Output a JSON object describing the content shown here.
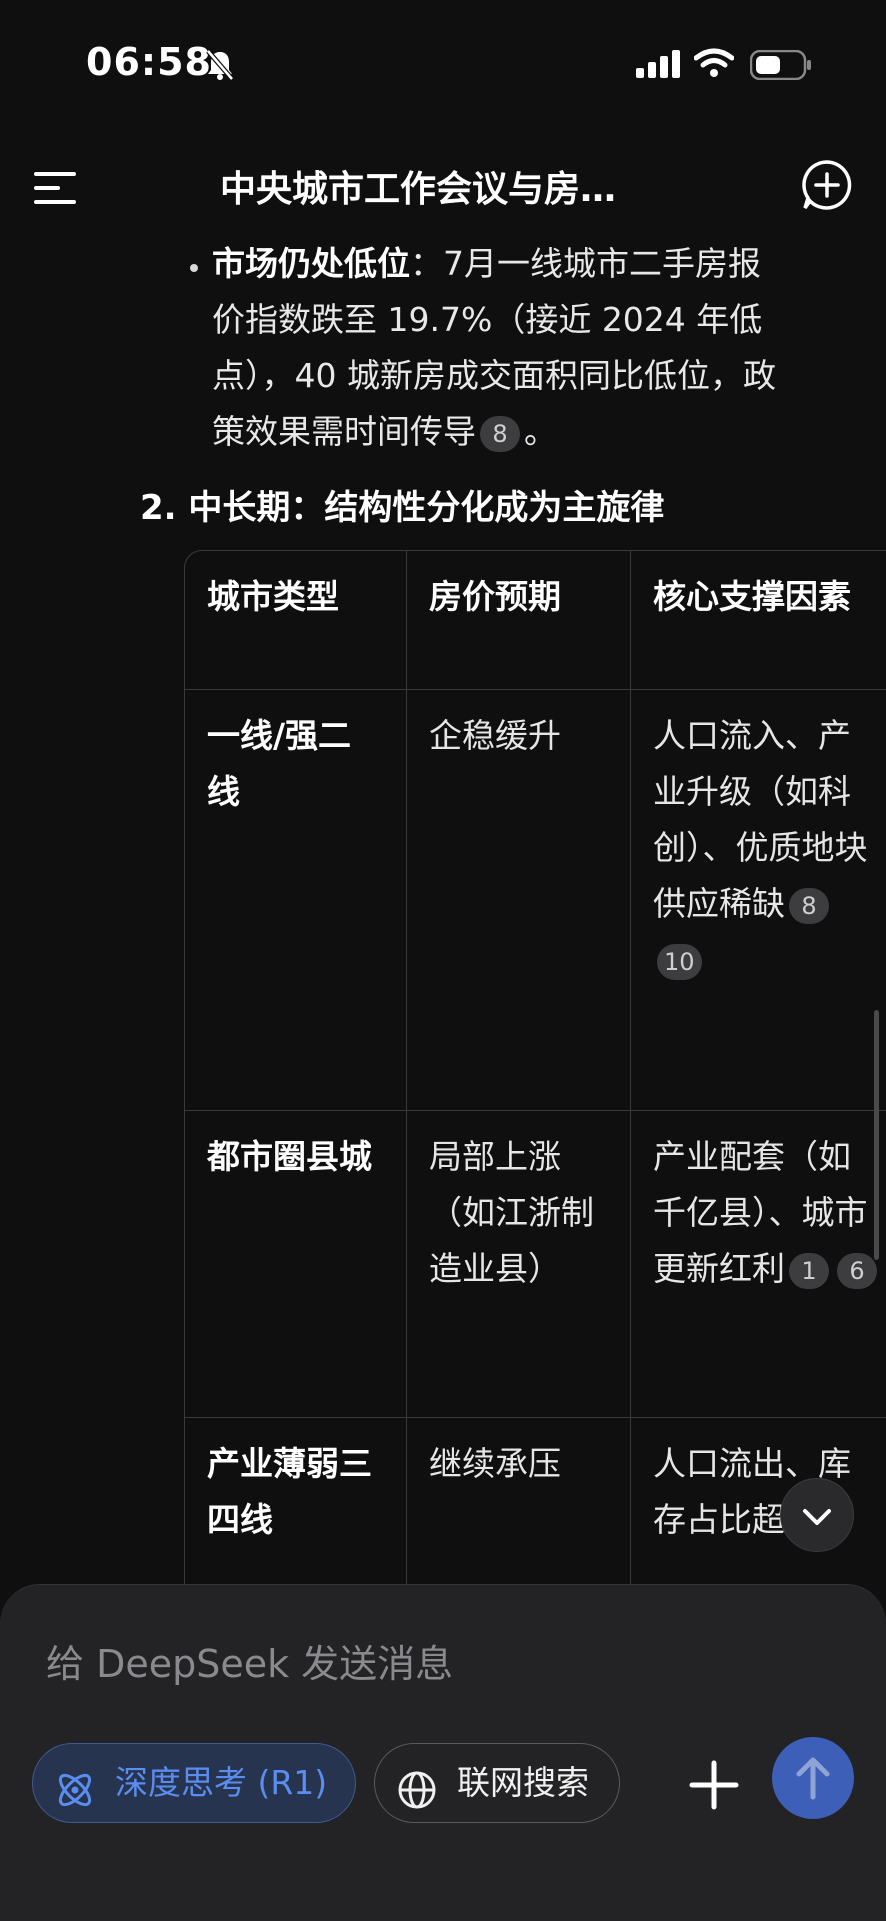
{
  "status_bar": {
    "time": "06:58"
  },
  "header": {
    "title": "中央城市工作会议与房…"
  },
  "content": {
    "bullet": {
      "bold": "市场仍处低位",
      "line1_rest": "：7月一线城市二手房报",
      "line2": "价指数跌至 19.7%（接近 2024 年低",
      "line3": "点），40 城新房成交面积同比低位，政",
      "line4": "策效果需时间传导",
      "cite": "8",
      "tail": "。"
    },
    "section_heading": "2. 中长期：结构性分化成为主旋律",
    "table": {
      "headers": [
        "城市类型",
        "房价预期",
        "核心支撑因素"
      ],
      "rows": [
        {
          "type": "一线/强二线",
          "expect": "企稳缓升",
          "factors": "人口流入、产业升级（如科创）、优质地块供应稀缺",
          "cites": [
            "8",
            "10"
          ]
        },
        {
          "type": "都市圈县城",
          "expect": "局部上涨（如江浙制造业县）",
          "factors": "产业配套（如千亿县）、城市更新红利",
          "cites": [
            "1",
            "6"
          ]
        },
        {
          "type": "产业薄弱三四线",
          "expect": "继续承压",
          "factors": "人口流出、库存占比超",
          "cites": []
        }
      ]
    }
  },
  "composer": {
    "placeholder": "给 DeepSeek 发送消息",
    "deep_think_label": "深度思考 (R1)",
    "web_search_label": "联网搜索"
  },
  "colors": {
    "background": "#0f0f10",
    "accent": "#5b8cf0",
    "send": "#3e5fb8"
  },
  "icons": [
    "bell-off-icon",
    "signal-icon",
    "wifi-icon",
    "battery-icon",
    "menu-icon",
    "new-chat-icon",
    "chevron-down-icon",
    "atom-icon",
    "globe-icon",
    "plus-icon",
    "arrow-up-icon"
  ]
}
